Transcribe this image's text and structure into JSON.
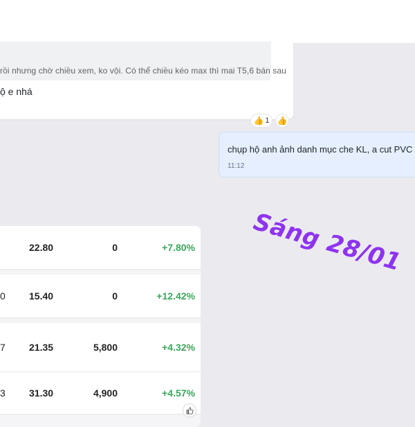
{
  "incoming_message": {
    "quote_text": "rồi nhưng chờ chiều xem, ko vội. Có thể chiều kéo max thì mai T5,6 bán sau",
    "text": "ộ e nhá",
    "reactions": [
      {
        "emoji": "👍",
        "count": "1"
      },
      {
        "emoji": "👍"
      }
    ]
  },
  "outgoing_message": {
    "text": "chụp hộ anh ảnh danh mục che KL, a cut PVC",
    "time": "11:12"
  },
  "annotation": {
    "text": "Sáng 28/01",
    "color": "#8e33f0"
  },
  "stock_table": {
    "rows": [
      {
        "code": "",
        "price": "22.80",
        "volume": "0",
        "change": "+7.80%"
      },
      {
        "code": "0",
        "price": "15.40",
        "volume": "0",
        "change": "+12.42%"
      },
      {
        "code": "7",
        "price": "21.35",
        "volume": "5,800",
        "change": "+4.32%"
      },
      {
        "code": "3",
        "price": "31.30",
        "volume": "4,900",
        "change": "+4.57%"
      }
    ],
    "positive_color": "#3ba55c"
  },
  "like_icon": "thumbs-up-icon"
}
